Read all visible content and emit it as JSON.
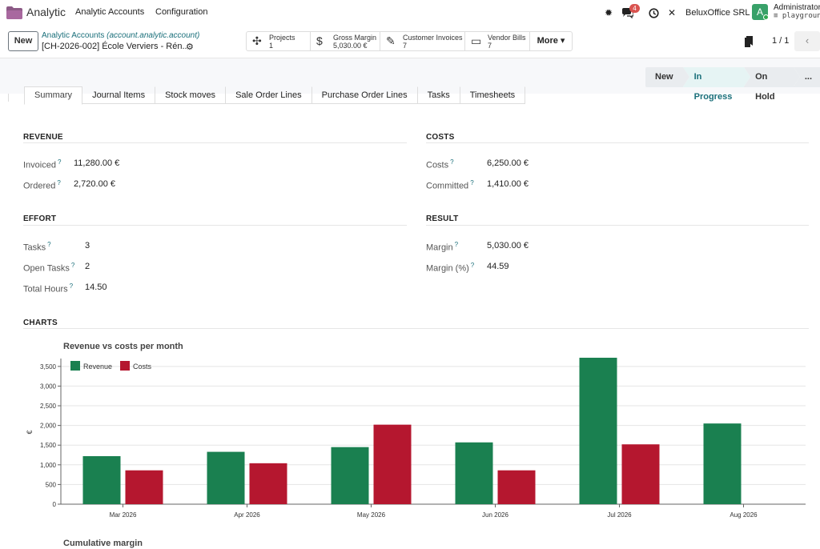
{
  "navbar": {
    "app_name": "Analytic",
    "menu": [
      "Analytic Accounts",
      "Configuration"
    ],
    "notifications_count": "4",
    "company": "BeluxOffice SRL",
    "avatar_letter": "A",
    "user_name": "Administrator",
    "database": "playground"
  },
  "control": {
    "new_label": "New",
    "breadcrumb_link": "Analytic Accounts",
    "breadcrumb_model": "(account.analytic.account)",
    "record_name": "[CH-2026-002] École Verviers - Rén...",
    "pager": "1 / 1",
    "smart_buttons": [
      {
        "icon": "puzzle-icon",
        "glyph": "✣",
        "label": "Projects",
        "value": "1"
      },
      {
        "icon": "dollar-icon",
        "glyph": "$",
        "label": "Gross Margin",
        "value": "5,030.00 €"
      },
      {
        "icon": "pencil-square-icon",
        "glyph": "✎",
        "label": "Customer Invoices",
        "value": "7"
      },
      {
        "icon": "file-icon",
        "glyph": "▭",
        "label": "Vendor Bills",
        "value": "7"
      }
    ],
    "more_label": "More ▾"
  },
  "statusbar": {
    "stages": [
      "New",
      "In Progress",
      "On Hold",
      "..."
    ],
    "active": "In Progress"
  },
  "tabs": [
    "Summary",
    "Journal Items",
    "Stock moves",
    "Sale Order Lines",
    "Purchase Order Lines",
    "Tasks",
    "Timesheets"
  ],
  "active_tab": "Summary",
  "summary": {
    "revenue": {
      "title": "REVENUE",
      "fields": [
        {
          "label": "Invoiced",
          "value": "11,280.00 €"
        },
        {
          "label": "Ordered",
          "value": "2,720.00 €"
        }
      ]
    },
    "costs": {
      "title": "COSTS",
      "fields": [
        {
          "label": "Costs",
          "value": "6,250.00 €"
        },
        {
          "label": "Committed",
          "value": "1,410.00 €"
        }
      ]
    },
    "effort": {
      "title": "EFFORT",
      "fields": [
        {
          "label": "Tasks",
          "value": "3"
        },
        {
          "label": "Open Tasks",
          "value": "2"
        },
        {
          "label": "Total Hours",
          "value": "14.50"
        }
      ]
    },
    "result": {
      "title": "RESULT",
      "fields": [
        {
          "label": "Margin",
          "value": "5,030.00 €"
        },
        {
          "label": "Margin (%)",
          "value": "44.59"
        }
      ]
    },
    "charts_title": "CHARTS",
    "help_mark": "?"
  },
  "chart_data": [
    {
      "type": "bar",
      "title": "Revenue vs costs per month",
      "ylabel": "€",
      "categories": [
        "Mar 2026",
        "Apr 2026",
        "May 2026",
        "Jun 2026",
        "Jul 2026",
        "Aug 2026"
      ],
      "series": [
        {
          "name": "Revenue",
          "color": "#1a8050",
          "values": [
            1220,
            1330,
            1450,
            1570,
            3720,
            2050
          ]
        },
        {
          "name": "Costs",
          "color": "#b5172f",
          "values": [
            860,
            1040,
            2020,
            860,
            1520,
            0
          ]
        }
      ],
      "ylim": [
        0,
        3700
      ],
      "yticks": [
        0,
        500,
        1000,
        1500,
        2000,
        2500,
        3000,
        3500
      ],
      "ytick_labels": [
        "0",
        "500",
        "1,000",
        "1,500",
        "2,000",
        "2,500",
        "3,000",
        "3,500"
      ],
      "grid": true,
      "legend": "top-left"
    },
    {
      "type": "line",
      "title": "Cumulative margin"
    }
  ]
}
